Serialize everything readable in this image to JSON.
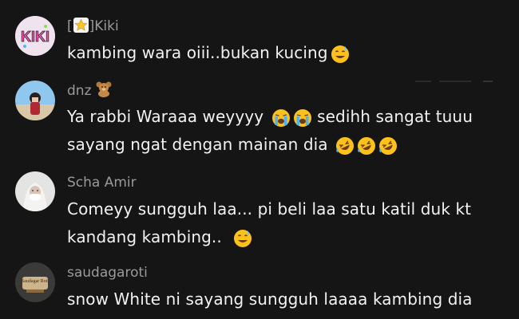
{
  "comments": [
    {
      "username_prefix": "[",
      "username_suffix": "]Kiki",
      "lines": [
        "kambing wara oiii..bukan kucing"
      ],
      "avatar_text": "KIKI"
    },
    {
      "username": "dnz",
      "lines": [
        "Ya rabbi Waraaa weyyyy",
        "sedihh sangat tuuu",
        "sayang ngat dengan mainan dia"
      ]
    },
    {
      "username": "Scha Amir",
      "lines": [
        "Comeyy sungguh laa... pi beli laa satu katil duk kt",
        "kandang kambing.."
      ]
    },
    {
      "username": "saudagaroti",
      "lines": [
        "snow White ni sayang sungguh laaaa kambing dia"
      ],
      "avatar_text": "Saudagar Roti"
    }
  ],
  "colors": {
    "background": "#151515",
    "username": "#9a9a9a",
    "text": "#f2f2f2"
  },
  "icons": [
    "star-icon",
    "teddy-bear-icon",
    "sweat-smile-emoji",
    "loudly-crying-emoji",
    "rolling-laughing-emoji"
  ]
}
